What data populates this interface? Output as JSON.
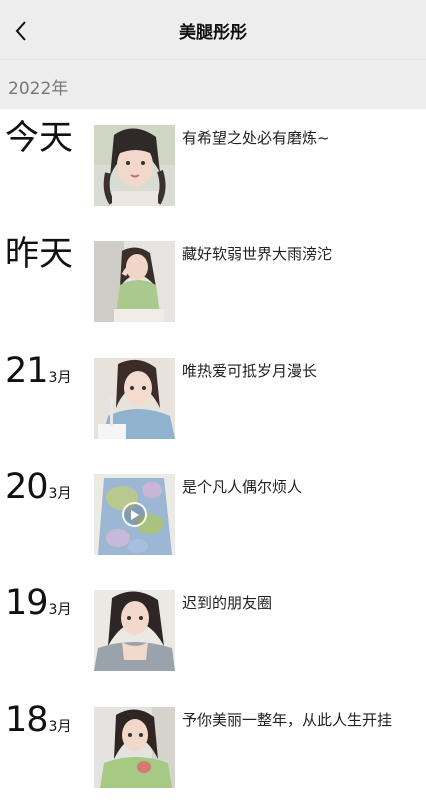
{
  "nav": {
    "title": "美腿彤彤",
    "back_icon": "chevron-left-icon"
  },
  "year_label": "2022年",
  "posts": [
    {
      "date_big": "今天",
      "day": "",
      "month": "",
      "text": "有希望之处必有磨炼~",
      "photo": "selfie with twin braids",
      "video": false
    },
    {
      "date_big": "昨天",
      "day": "",
      "month": "",
      "text": "藏好软弱世界大雨滂沱",
      "photo": "girl in green shirt sitting",
      "video": false
    },
    {
      "date_big": "",
      "day": "21",
      "month": "3月",
      "text": "唯热爱可抵岁月漫长",
      "photo": "girl in blue sweater with drink",
      "video": false
    },
    {
      "date_big": "",
      "day": "20",
      "month": "3月",
      "text": "是个凡人偶尔烦人",
      "photo": "tie-dye shirt",
      "video": true
    },
    {
      "date_big": "",
      "day": "19",
      "month": "3月",
      "text": "迟到的朋友圈",
      "photo": "girl in grey off-shoulder top",
      "video": false
    },
    {
      "date_big": "",
      "day": "18",
      "month": "3月",
      "text": "予你美丽一整年，从此人生开挂",
      "photo": "girl in green shirt with plush",
      "video": false
    }
  ],
  "colors": {
    "nav_bg": "#ededed",
    "year_text": "#777777",
    "text": "#222222"
  }
}
